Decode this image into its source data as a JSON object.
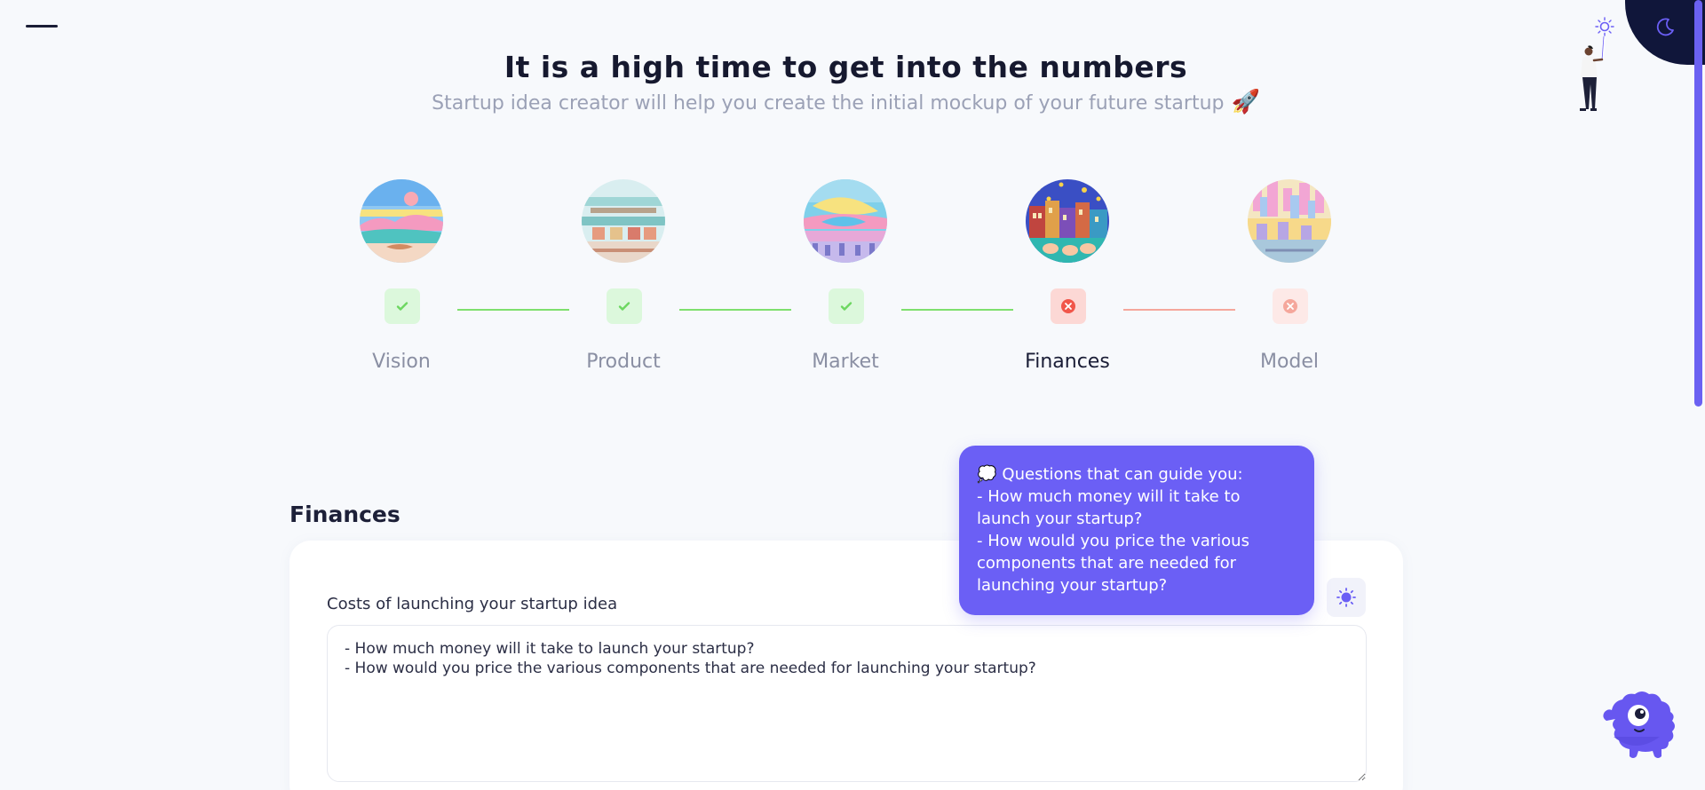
{
  "hero": {
    "title": "It is a high time to get into the numbers",
    "subtitle": "Startup idea creator will help you create the initial mockup of your future startup",
    "subtitle_emoji": "🚀"
  },
  "steps": [
    {
      "label": "Vision",
      "status": "done",
      "image": "vision-illustration"
    },
    {
      "label": "Product",
      "status": "done",
      "image": "product-illustration"
    },
    {
      "label": "Market",
      "status": "done",
      "image": "market-illustration"
    },
    {
      "label": "Finances",
      "status": "error",
      "active": true,
      "image": "finances-illustration"
    },
    {
      "label": "Model",
      "status": "pending-error",
      "image": "model-illustration"
    }
  ],
  "section": {
    "title": "Finances",
    "field_label": "Costs of launching your startup idea",
    "field_value": "- How much money will it take to launch your startup?\n- How would you price the various components that are needed for launching your startup?"
  },
  "tooltip": {
    "icon": "💭",
    "heading": "Questions that can guide you:",
    "line1": "- How much money will it take to launch your startup?",
    "line2": "- How would you price the various components that are needed for launching your startup?"
  },
  "icons": {
    "menu": "hamburger-icon",
    "theme_light": "sun-icon",
    "theme_dark": "moon-icon",
    "hint": "lightbulb-icon",
    "check": "check-icon",
    "error": "x-circle-icon",
    "assistant": "monster-mascot-icon"
  },
  "colors": {
    "accent": "#6b5ff5",
    "success": "#6cd760",
    "success_bg": "#dcf8dc",
    "error": "#f1564a",
    "error_bg": "#fcd8d5",
    "dark_corner": "#10163a",
    "page_bg": "#f7f9fc"
  }
}
